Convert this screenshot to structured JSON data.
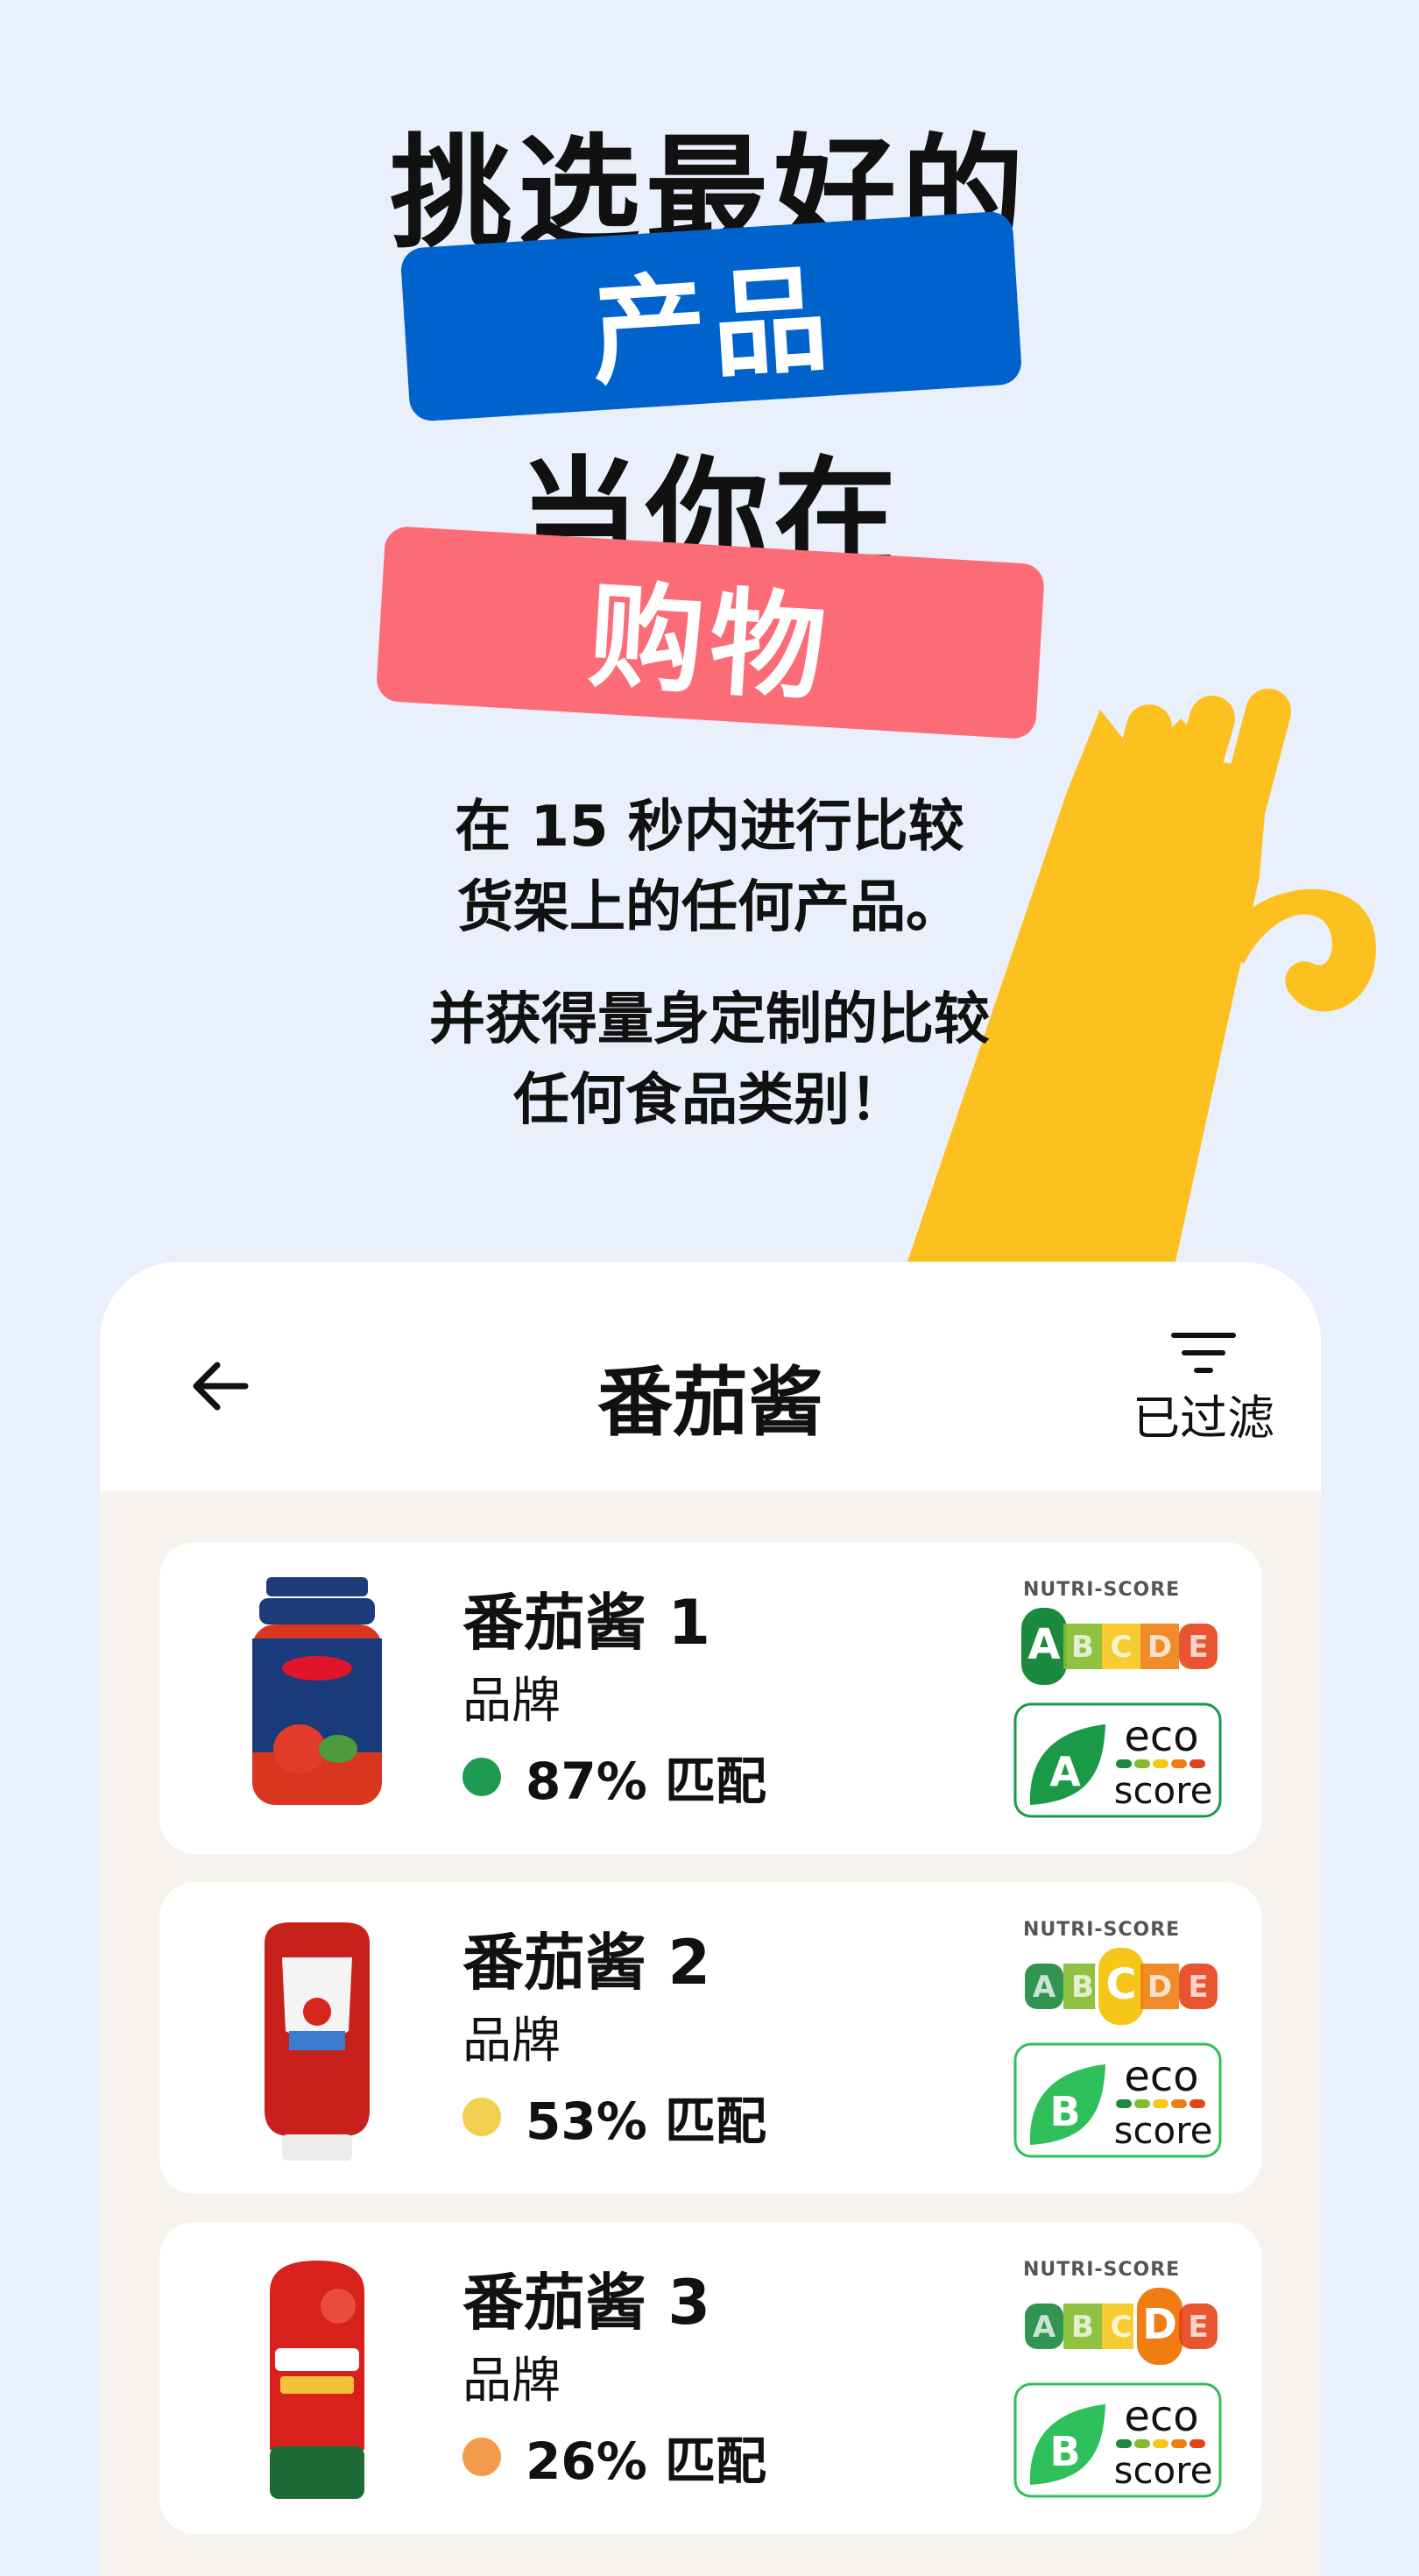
{
  "hero": {
    "line1": "挑选最好的",
    "line2": "产品",
    "line3": "当你在",
    "line4": "购物",
    "desc1": [
      "在 15 秒内进行比较",
      "货架上的任何产品。"
    ],
    "desc2": [
      "并获得量身定制的比较",
      "任何食品类别！"
    ]
  },
  "colors": {
    "background": "#e9effb",
    "blue_pill": "#0062cc",
    "pink_pill": "#fc6c77",
    "hand": "#fcc11f"
  },
  "screen": {
    "back_icon": "arrow-left-icon",
    "title": "番茄酱",
    "filter_icon": "filter-icon",
    "filter_label": "已过滤"
  },
  "products": [
    {
      "name": "番茄酱 1",
      "brand": "品牌",
      "match": "87% 匹配",
      "match_color": "#1f9a52",
      "nutri_label": "NUTRI-SCORE",
      "nutri_grade": "A",
      "eco_grade": "A",
      "eco_word1": "eco",
      "eco_word2": "score"
    },
    {
      "name": "番茄酱 2",
      "brand": "品牌",
      "match": "53% 匹配",
      "match_color": "#f2cf4e",
      "nutri_label": "NUTRI-SCORE",
      "nutri_grade": "C",
      "eco_grade": "B",
      "eco_word1": "eco",
      "eco_word2": "score"
    },
    {
      "name": "番茄酱 3",
      "brand": "品牌",
      "match": "26% 匹配",
      "match_color": "#f49a4c",
      "nutri_label": "NUTRI-SCORE",
      "nutri_grade": "D",
      "eco_grade": "B",
      "eco_word1": "eco",
      "eco_word2": "score"
    }
  ],
  "nutri_letters": [
    "A",
    "B",
    "C",
    "D",
    "E"
  ]
}
